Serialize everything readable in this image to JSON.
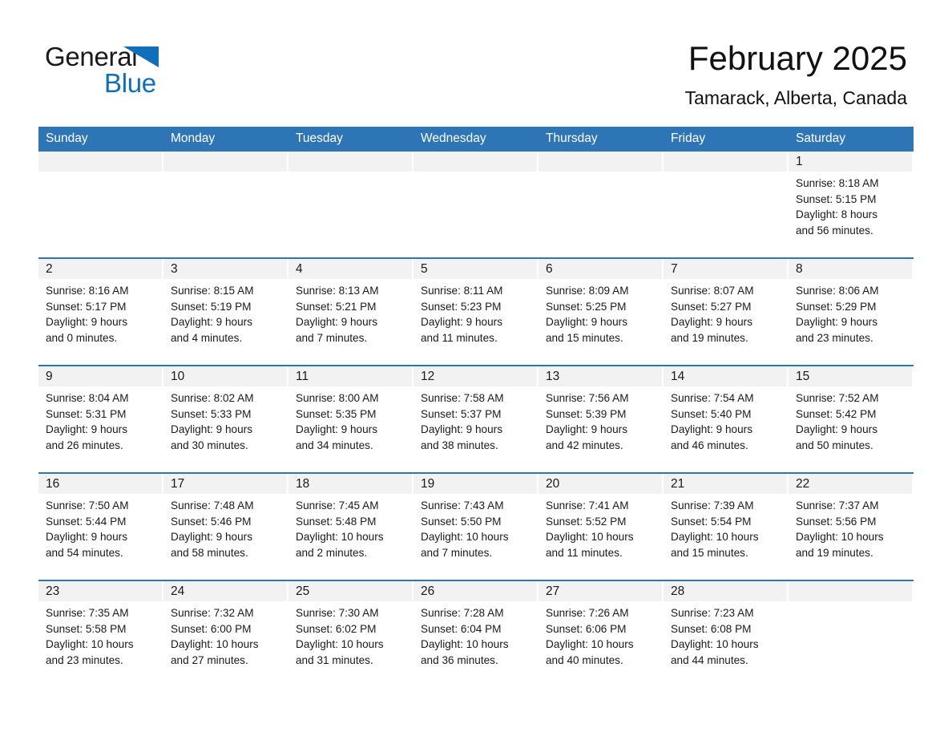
{
  "logo": {
    "text_top": "General",
    "text_bottom": "Blue",
    "triangle_color": "#0F6FB8"
  },
  "header": {
    "month_title": "February 2025",
    "location": "Tamarack, Alberta, Canada"
  },
  "theme": {
    "header_blue": "#2E75B6",
    "daynum_band": "#F2F2F2",
    "text": "#1a1a1a"
  },
  "weekdays": [
    "Sunday",
    "Monday",
    "Tuesday",
    "Wednesday",
    "Thursday",
    "Friday",
    "Saturday"
  ],
  "weeks": [
    [
      {
        "day": "",
        "sunrise": "",
        "sunset": "",
        "daylight1": "",
        "daylight2": ""
      },
      {
        "day": "",
        "sunrise": "",
        "sunset": "",
        "daylight1": "",
        "daylight2": ""
      },
      {
        "day": "",
        "sunrise": "",
        "sunset": "",
        "daylight1": "",
        "daylight2": ""
      },
      {
        "day": "",
        "sunrise": "",
        "sunset": "",
        "daylight1": "",
        "daylight2": ""
      },
      {
        "day": "",
        "sunrise": "",
        "sunset": "",
        "daylight1": "",
        "daylight2": ""
      },
      {
        "day": "",
        "sunrise": "",
        "sunset": "",
        "daylight1": "",
        "daylight2": ""
      },
      {
        "day": "1",
        "sunrise": "Sunrise: 8:18 AM",
        "sunset": "Sunset: 5:15 PM",
        "daylight1": "Daylight: 8 hours",
        "daylight2": "and 56 minutes."
      }
    ],
    [
      {
        "day": "2",
        "sunrise": "Sunrise: 8:16 AM",
        "sunset": "Sunset: 5:17 PM",
        "daylight1": "Daylight: 9 hours",
        "daylight2": "and 0 minutes."
      },
      {
        "day": "3",
        "sunrise": "Sunrise: 8:15 AM",
        "sunset": "Sunset: 5:19 PM",
        "daylight1": "Daylight: 9 hours",
        "daylight2": "and 4 minutes."
      },
      {
        "day": "4",
        "sunrise": "Sunrise: 8:13 AM",
        "sunset": "Sunset: 5:21 PM",
        "daylight1": "Daylight: 9 hours",
        "daylight2": "and 7 minutes."
      },
      {
        "day": "5",
        "sunrise": "Sunrise: 8:11 AM",
        "sunset": "Sunset: 5:23 PM",
        "daylight1": "Daylight: 9 hours",
        "daylight2": "and 11 minutes."
      },
      {
        "day": "6",
        "sunrise": "Sunrise: 8:09 AM",
        "sunset": "Sunset: 5:25 PM",
        "daylight1": "Daylight: 9 hours",
        "daylight2": "and 15 minutes."
      },
      {
        "day": "7",
        "sunrise": "Sunrise: 8:07 AM",
        "sunset": "Sunset: 5:27 PM",
        "daylight1": "Daylight: 9 hours",
        "daylight2": "and 19 minutes."
      },
      {
        "day": "8",
        "sunrise": "Sunrise: 8:06 AM",
        "sunset": "Sunset: 5:29 PM",
        "daylight1": "Daylight: 9 hours",
        "daylight2": "and 23 minutes."
      }
    ],
    [
      {
        "day": "9",
        "sunrise": "Sunrise: 8:04 AM",
        "sunset": "Sunset: 5:31 PM",
        "daylight1": "Daylight: 9 hours",
        "daylight2": "and 26 minutes."
      },
      {
        "day": "10",
        "sunrise": "Sunrise: 8:02 AM",
        "sunset": "Sunset: 5:33 PM",
        "daylight1": "Daylight: 9 hours",
        "daylight2": "and 30 minutes."
      },
      {
        "day": "11",
        "sunrise": "Sunrise: 8:00 AM",
        "sunset": "Sunset: 5:35 PM",
        "daylight1": "Daylight: 9 hours",
        "daylight2": "and 34 minutes."
      },
      {
        "day": "12",
        "sunrise": "Sunrise: 7:58 AM",
        "sunset": "Sunset: 5:37 PM",
        "daylight1": "Daylight: 9 hours",
        "daylight2": "and 38 minutes."
      },
      {
        "day": "13",
        "sunrise": "Sunrise: 7:56 AM",
        "sunset": "Sunset: 5:39 PM",
        "daylight1": "Daylight: 9 hours",
        "daylight2": "and 42 minutes."
      },
      {
        "day": "14",
        "sunrise": "Sunrise: 7:54 AM",
        "sunset": "Sunset: 5:40 PM",
        "daylight1": "Daylight: 9 hours",
        "daylight2": "and 46 minutes."
      },
      {
        "day": "15",
        "sunrise": "Sunrise: 7:52 AM",
        "sunset": "Sunset: 5:42 PM",
        "daylight1": "Daylight: 9 hours",
        "daylight2": "and 50 minutes."
      }
    ],
    [
      {
        "day": "16",
        "sunrise": "Sunrise: 7:50 AM",
        "sunset": "Sunset: 5:44 PM",
        "daylight1": "Daylight: 9 hours",
        "daylight2": "and 54 minutes."
      },
      {
        "day": "17",
        "sunrise": "Sunrise: 7:48 AM",
        "sunset": "Sunset: 5:46 PM",
        "daylight1": "Daylight: 9 hours",
        "daylight2": "and 58 minutes."
      },
      {
        "day": "18",
        "sunrise": "Sunrise: 7:45 AM",
        "sunset": "Sunset: 5:48 PM",
        "daylight1": "Daylight: 10 hours",
        "daylight2": "and 2 minutes."
      },
      {
        "day": "19",
        "sunrise": "Sunrise: 7:43 AM",
        "sunset": "Sunset: 5:50 PM",
        "daylight1": "Daylight: 10 hours",
        "daylight2": "and 7 minutes."
      },
      {
        "day": "20",
        "sunrise": "Sunrise: 7:41 AM",
        "sunset": "Sunset: 5:52 PM",
        "daylight1": "Daylight: 10 hours",
        "daylight2": "and 11 minutes."
      },
      {
        "day": "21",
        "sunrise": "Sunrise: 7:39 AM",
        "sunset": "Sunset: 5:54 PM",
        "daylight1": "Daylight: 10 hours",
        "daylight2": "and 15 minutes."
      },
      {
        "day": "22",
        "sunrise": "Sunrise: 7:37 AM",
        "sunset": "Sunset: 5:56 PM",
        "daylight1": "Daylight: 10 hours",
        "daylight2": "and 19 minutes."
      }
    ],
    [
      {
        "day": "23",
        "sunrise": "Sunrise: 7:35 AM",
        "sunset": "Sunset: 5:58 PM",
        "daylight1": "Daylight: 10 hours",
        "daylight2": "and 23 minutes."
      },
      {
        "day": "24",
        "sunrise": "Sunrise: 7:32 AM",
        "sunset": "Sunset: 6:00 PM",
        "daylight1": "Daylight: 10 hours",
        "daylight2": "and 27 minutes."
      },
      {
        "day": "25",
        "sunrise": "Sunrise: 7:30 AM",
        "sunset": "Sunset: 6:02 PM",
        "daylight1": "Daylight: 10 hours",
        "daylight2": "and 31 minutes."
      },
      {
        "day": "26",
        "sunrise": "Sunrise: 7:28 AM",
        "sunset": "Sunset: 6:04 PM",
        "daylight1": "Daylight: 10 hours",
        "daylight2": "and 36 minutes."
      },
      {
        "day": "27",
        "sunrise": "Sunrise: 7:26 AM",
        "sunset": "Sunset: 6:06 PM",
        "daylight1": "Daylight: 10 hours",
        "daylight2": "and 40 minutes."
      },
      {
        "day": "28",
        "sunrise": "Sunrise: 7:23 AM",
        "sunset": "Sunset: 6:08 PM",
        "daylight1": "Daylight: 10 hours",
        "daylight2": "and 44 minutes."
      },
      {
        "day": "",
        "sunrise": "",
        "sunset": "",
        "daylight1": "",
        "daylight2": ""
      }
    ]
  ]
}
